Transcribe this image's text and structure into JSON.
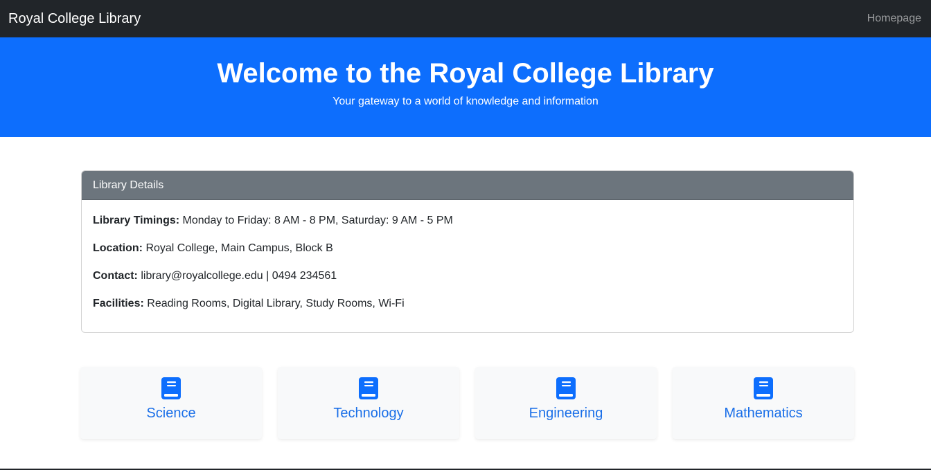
{
  "navbar": {
    "brand": "Royal College Library",
    "link": "Homepage"
  },
  "hero": {
    "title": "Welcome to the Royal College Library",
    "subtitle": "Your gateway to a world of knowledge and information"
  },
  "library_details": {
    "header": "Library Details",
    "items": [
      {
        "label": "Library Timings:",
        "value": " Monday to Friday: 8 AM - 8 PM, Saturday: 9 AM - 5 PM"
      },
      {
        "label": "Location:",
        "value": " Royal College, Main Campus, Block B"
      },
      {
        "label": "Contact:",
        "value": " library@royalcollege.edu | 0494 234561"
      },
      {
        "label": "Facilities:",
        "value": " Reading Rooms, Digital Library, Study Rooms, Wi-Fi"
      }
    ]
  },
  "categories": [
    {
      "label": "Science",
      "icon": "book-icon"
    },
    {
      "label": "Technology",
      "icon": "book-icon"
    },
    {
      "label": "Engineering",
      "icon": "book-icon"
    },
    {
      "label": "Mathematics",
      "icon": "book-icon"
    }
  ],
  "colors": {
    "navbar": "#212529",
    "hero": "#0d6efd",
    "card_header": "#6c757d",
    "category_text": "#1a6fe8"
  }
}
